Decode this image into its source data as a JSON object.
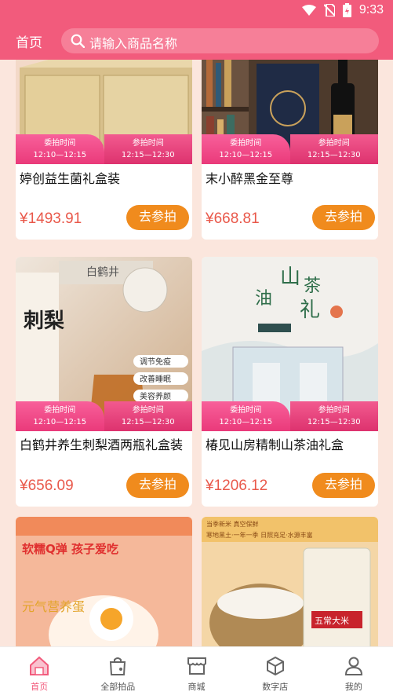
{
  "status_bar": {
    "time": "9:33"
  },
  "header": {
    "home_label": "首页",
    "search_placeholder": "请输入商品名称"
  },
  "cards": [
    {
      "title": "婷创益生菌礼盒装",
      "price": "¥1493.91",
      "button": "去参拍",
      "left_label": "委拍时间",
      "left_time": "12:10—12:15",
      "right_label": "参拍时间",
      "right_time": "12:15—12:30"
    },
    {
      "title": "末小醉黑金至尊",
      "price": "¥668.81",
      "button": "去参拍",
      "left_label": "委拍时间",
      "left_time": "12:10—12:15",
      "right_label": "参拍时间",
      "right_time": "12:15—12:30"
    },
    {
      "title": "白鹤井养生刺梨酒两瓶礼盒装",
      "price": "¥656.09",
      "button": "去参拍",
      "left_label": "委拍时间",
      "left_time": "12:10—12:15",
      "right_label": "参拍时间",
      "right_time": "12:15—12:30"
    },
    {
      "title": "椿见山房精制山茶油礼盒",
      "price": "¥1206.12",
      "button": "去参拍",
      "left_label": "委拍时间",
      "left_time": "12:10—12:15",
      "right_label": "参拍时间",
      "right_time": "12:15—12:30"
    }
  ],
  "image_text": {
    "bottle_brand": "白鹤井",
    "cili": "刺梨",
    "tag_a": "调节免疫",
    "tag_b": "改善睡眠",
    "tag_c": "美容养颜",
    "shancha_a": "山",
    "shancha_b": "茶",
    "shancha_c": "油",
    "shancha_d": "礼",
    "egg_slogan": "软糯Q弹 孩子爱吃",
    "egg_label": "元气营养蛋",
    "rice_top": "当季新米 真空保鲜",
    "rice_slogan": "寒地黑土·一年一季 日照充足·水源丰富",
    "rice_bag": "五常大米"
  },
  "tabs": [
    {
      "label": "首页",
      "icon": "home-icon",
      "active": true
    },
    {
      "label": "全部拍品",
      "icon": "bag-icon",
      "active": false
    },
    {
      "label": "商城",
      "icon": "shop-icon",
      "active": false
    },
    {
      "label": "数字店",
      "icon": "cube-icon",
      "active": false
    },
    {
      "label": "我的",
      "icon": "user-icon",
      "active": false
    }
  ],
  "colors": {
    "brand": "#f25b7c",
    "button": "#f08b1d",
    "price": "#e9584a",
    "background": "#fbe6dd"
  }
}
